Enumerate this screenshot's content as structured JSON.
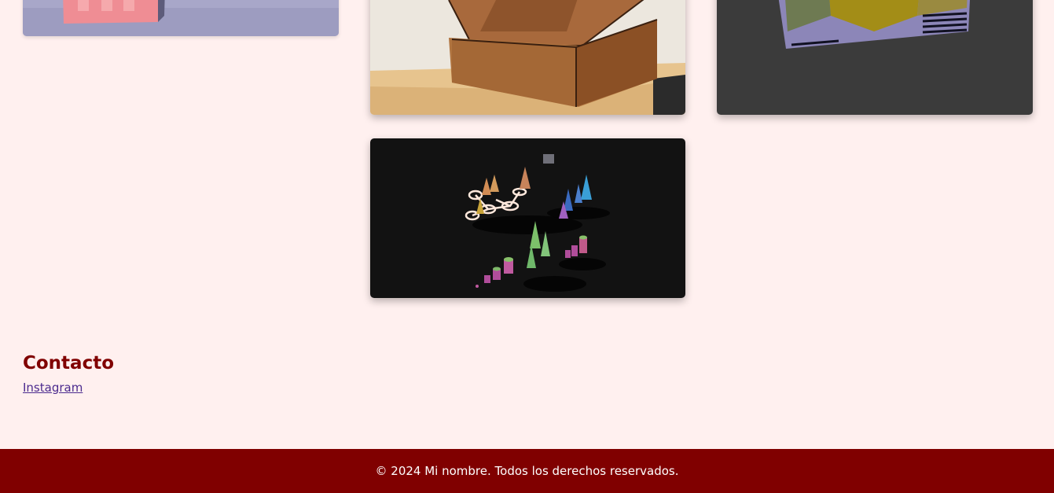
{
  "gallery": {
    "items": [
      {
        "alt": "pink perforated object on lavender surface"
      },
      {
        "alt": "wooden faceted sculpture on wooden base"
      },
      {
        "alt": "faceted tiled object on dark background"
      },
      {
        "alt": "3D render of colorful cones on black background"
      }
    ]
  },
  "contact": {
    "heading": "Contacto",
    "instagram_label": "Instagram"
  },
  "footer": {
    "copyright": "© 2024 Mi nombre. Todos los derechos reservados."
  },
  "colors": {
    "background": "#fff0ef",
    "accent": "#800000",
    "link": "#4b2a8e"
  }
}
